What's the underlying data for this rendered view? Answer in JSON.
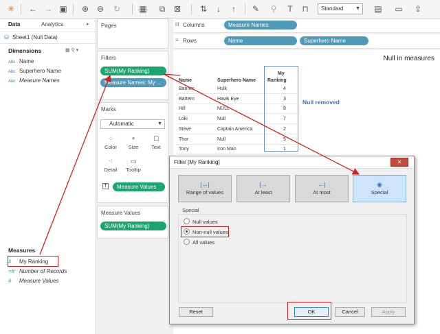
{
  "toolbar": {
    "standard": "Standard"
  },
  "left": {
    "tabs": [
      "Data",
      "Analytics"
    ],
    "datasource": "Sheet1 (Null Data)",
    "dimensions_title": "Dimensions",
    "dimensions": [
      "Name",
      "Superhero Name",
      "Measure Names"
    ],
    "measures_title": "Measures",
    "measures": [
      "My Ranking",
      "Number of Records",
      "Measure Values"
    ]
  },
  "shelves": {
    "pages": "Pages",
    "filters": "Filters",
    "filter_pills": [
      "SUM(My Ranking)",
      "Measure Names: My ..."
    ],
    "marks": "Marks",
    "mark_type": "Automatic",
    "mark_cells": [
      "Color",
      "Size",
      "Text",
      "Detail",
      "Tooltip"
    ],
    "marks_pill": "Measure Values",
    "measure_values_title": "Measure Values",
    "measure_values_pill": "SUM(My Ranking)",
    "columns_label": "Columns",
    "columns_pill": "Measure Names",
    "rows_label": "Rows",
    "rows_pills": [
      "Name",
      "Superhero Name"
    ]
  },
  "view": {
    "title": "Null in measures",
    "headers": {
      "name": "Name",
      "hero": "Superhero Name",
      "rank_1": "My",
      "rank_2": "Ranking"
    },
    "rows": [
      {
        "name": "Banner",
        "hero": "Hulk",
        "rank": "4"
      },
      {
        "name": "Bartern",
        "hero": "Hawk Eye",
        "rank": "3"
      },
      {
        "name": "Hill",
        "hero": "NULL",
        "rank": "8"
      },
      {
        "name": "Loki",
        "hero": "Null",
        "rank": "7"
      },
      {
        "name": "Steve",
        "hero": "Captain America",
        "rank": "2"
      },
      {
        "name": "Thor",
        "hero": "Null",
        "rank": "5"
      },
      {
        "name": "Tony",
        "hero": "Iron Man",
        "rank": "1"
      }
    ],
    "annotation": "Null removed"
  },
  "dialog": {
    "title": "Filter [My Ranking]",
    "modes": [
      "Range of values",
      "At least",
      "At most",
      "Special"
    ],
    "special_label": "Special",
    "options": [
      "Null values",
      "Non-null values",
      "All values"
    ],
    "buttons": {
      "reset": "Reset",
      "ok": "OK",
      "cancel": "Cancel",
      "apply": "Apply"
    }
  }
}
